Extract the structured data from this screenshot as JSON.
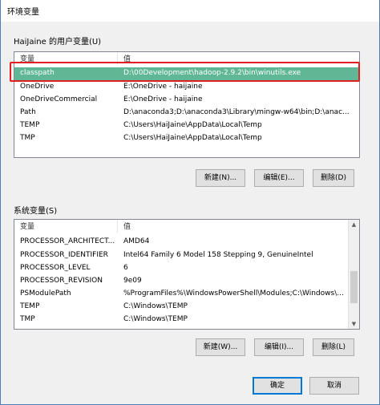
{
  "window": {
    "title": "环境变量"
  },
  "user_vars": {
    "label": "HaiJaine 的用户变量(U)",
    "col_name": "变量",
    "col_value": "值",
    "rows": [
      {
        "name": "classpath",
        "value": "D:\\00Development\\hadoop-2.9.2\\bin\\winutils.exe"
      },
      {
        "name": "OneDrive",
        "value": "E:\\OneDrive - haijaine"
      },
      {
        "name": "OneDriveCommercial",
        "value": "E:\\OneDrive - haijaine"
      },
      {
        "name": "Path",
        "value": "D:\\anaconda3;D:\\anaconda3\\Library\\mingw-w64\\bin;D:\\anac..."
      },
      {
        "name": "TEMP",
        "value": "C:\\Users\\HaiJaine\\AppData\\Local\\Temp"
      },
      {
        "name": "TMP",
        "value": "C:\\Users\\HaiJaine\\AppData\\Local\\Temp"
      }
    ],
    "new_label": "新建(N)...",
    "edit_label": "编辑(E)...",
    "delete_label": "删除(D)"
  },
  "sys_vars": {
    "label": "系统变量(S)",
    "col_name": "变量",
    "col_value": "值",
    "rows": [
      {
        "name": "PROCESSOR_ARCHITECT...",
        "value": "AMD64"
      },
      {
        "name": "PROCESSOR_IDENTIFIER",
        "value": "Intel64 Family 6 Model 158 Stepping 9, GenuineIntel"
      },
      {
        "name": "PROCESSOR_LEVEL",
        "value": "6"
      },
      {
        "name": "PROCESSOR_REVISION",
        "value": "9e09"
      },
      {
        "name": "PSModulePath",
        "value": "%ProgramFiles%\\WindowsPowerShell\\Modules;C:\\Windows\\..."
      },
      {
        "name": "TEMP",
        "value": "C:\\Windows\\TEMP"
      },
      {
        "name": "TMP",
        "value": "C:\\Windows\\TEMP"
      }
    ],
    "new_label": "新建(W)...",
    "edit_label": "编辑(I)...",
    "delete_label": "删除(L)"
  },
  "footer": {
    "ok_label": "确定",
    "cancel_label": "取消"
  },
  "colors": {
    "selected_row": "#5fb795",
    "highlight_border": "#e02020",
    "primary_border": "#0078d7"
  }
}
